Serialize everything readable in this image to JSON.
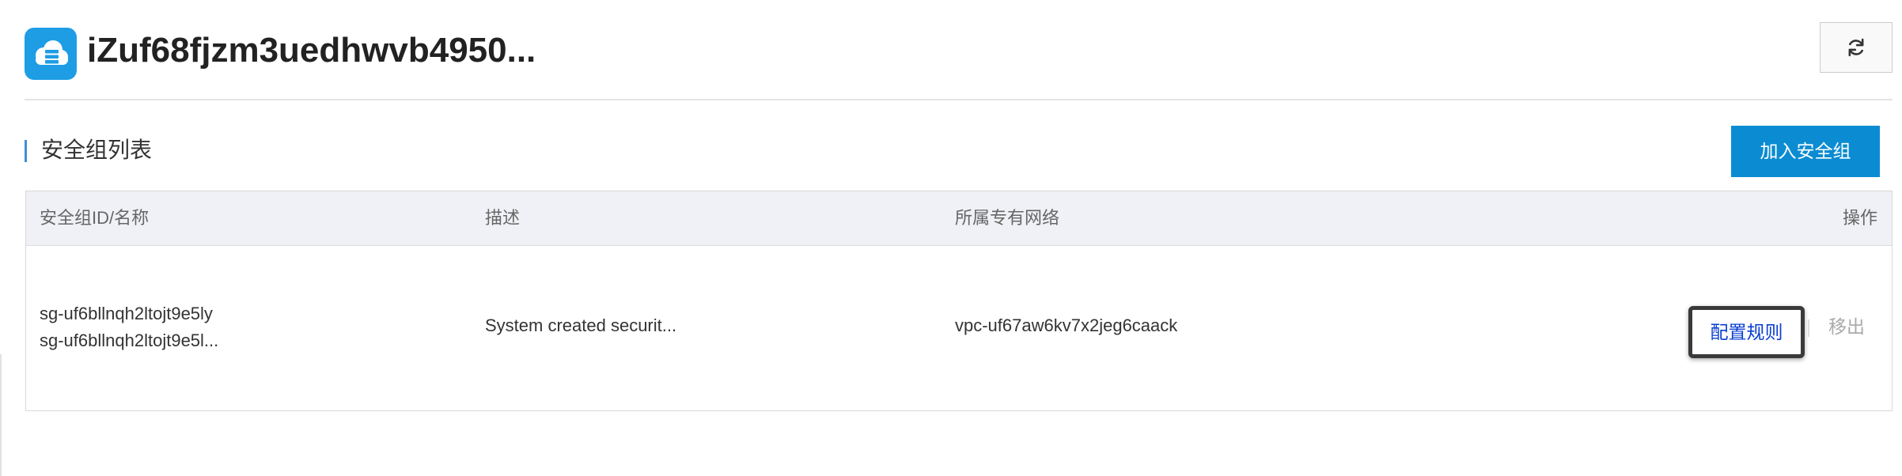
{
  "colors": {
    "accent": "#0b8cd2",
    "icon_bg": "#1e9de5",
    "link": "#0a3fd0",
    "muted": "#aaaaaa",
    "section_bar": "#3f8fd6"
  },
  "header": {
    "icon": "cloud-server-icon",
    "title": "iZuf68fjzm3uedhwvb4950...",
    "refresh_icon": "refresh-icon"
  },
  "section": {
    "title": "安全组列表",
    "add_button": "加入安全组"
  },
  "table": {
    "columns": [
      "安全组ID/名称",
      "描述",
      "所属专有网络",
      "操作"
    ],
    "rows": [
      {
        "id": "sg-uf6bllnqh2ltojt9e5ly",
        "name": "sg-uf6bllnqh2ltojt9e5l...",
        "description": "System created securit...",
        "vpc": "vpc-uf67aw6kv7x2jeg6caack",
        "actions": {
          "configure": "配置规则",
          "remove": "移出"
        }
      }
    ]
  }
}
